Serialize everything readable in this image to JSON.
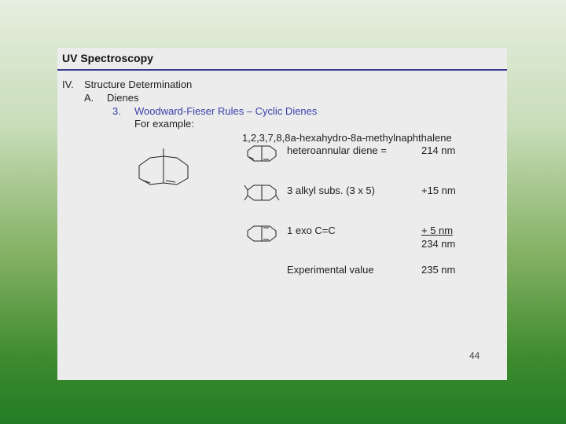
{
  "slide": {
    "title": "UV Spectroscopy",
    "outline": {
      "level1_num": "IV.",
      "level1_text": "Structure Determination",
      "level2_num": "A.",
      "level2_text": "Dienes",
      "level3_num": "3.",
      "level3_text": "Woodward-Fieser Rules – Cyclic Dienes",
      "example_label": "For example:"
    },
    "compound_name": "1,2,3,7,8,8a-hexahydro-8a-methylnaphthalene",
    "calc_rows": [
      {
        "label": "heteroannular diene =",
        "value": "214 nm"
      },
      {
        "label": "3 alkyl subs. (3 x 5)",
        "value": "+15 nm"
      },
      {
        "label": "1 exo C=C",
        "value": "+ 5 nm"
      }
    ],
    "total": "234 nm",
    "experimental_label": "Experimental value",
    "experimental_value": "235 nm",
    "page_number": "44",
    "accent_color": "#3a40a8"
  }
}
